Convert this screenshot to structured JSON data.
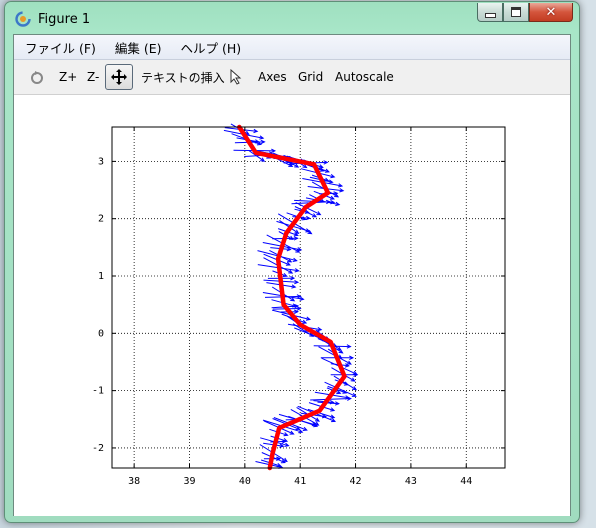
{
  "window": {
    "title": "Figure 1"
  },
  "menu": {
    "items": [
      "ファイル (F)",
      "編集 (E)",
      "ヘルプ (H)"
    ]
  },
  "toolbar": {
    "zoom_in": "Z+",
    "zoom_out": "Z-",
    "insert_text": "テキストの挿入",
    "axes": "Axes",
    "grid": "Grid",
    "autoscale": "Autoscale"
  },
  "chart_data": {
    "type": "line",
    "xlim": [
      37.6,
      44.7
    ],
    "ylim": [
      -2.35,
      3.6
    ],
    "x_ticks": [
      38,
      39,
      40,
      41,
      42,
      43,
      44
    ],
    "y_ticks": [
      -2,
      -1,
      0,
      1,
      2,
      3
    ],
    "grid": true,
    "series": [
      {
        "style": "line",
        "color": "#ff0000",
        "x": [
          40.45,
          40.5,
          40.62,
          41.35,
          41.8,
          41.55,
          41.0,
          40.7,
          40.6,
          40.75,
          41.1,
          41.5,
          41.25,
          40.2,
          39.9
        ],
        "y": [
          -2.35,
          -2.1,
          -1.65,
          -1.35,
          -0.75,
          -0.15,
          0.15,
          0.5,
          1.3,
          1.75,
          2.2,
          2.45,
          2.95,
          3.15,
          3.6
        ]
      },
      {
        "style": "quiver",
        "color": "#0000ff",
        "u_angle_deg": -15,
        "magnitude": [
          0.25,
          0.75
        ]
      }
    ]
  }
}
